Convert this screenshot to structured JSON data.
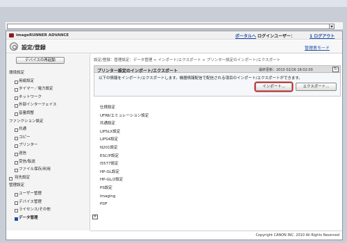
{
  "header": {
    "brand": "imageRUNNER ADVANCE",
    "portal_link": "ポータルへ",
    "user_label": "ログインユーザー：",
    "logout_link": "1 ログアウト"
  },
  "title_bar": {
    "title": "設定/登録",
    "to_admin_link": "管理者モード"
  },
  "sidebar": {
    "restart_button": "デバイスの再起動",
    "items": [
      {
        "type": "heading",
        "label": "環境設定"
      },
      {
        "type": "item",
        "label": "用紙設定"
      },
      {
        "type": "item",
        "label": "タイマー／電力設定"
      },
      {
        "type": "item",
        "label": "ネットワーク"
      },
      {
        "type": "item",
        "label": "外部インターフェイス"
      },
      {
        "type": "item",
        "label": "音量調整"
      },
      {
        "type": "heading",
        "label": "ファンクション設定"
      },
      {
        "type": "item",
        "label": "共通"
      },
      {
        "type": "item",
        "label": "コピー"
      },
      {
        "type": "item",
        "label": "プリンター"
      },
      {
        "type": "item",
        "label": "送信"
      },
      {
        "type": "item",
        "label": "受信/転送"
      },
      {
        "type": "item",
        "label": "ファイル保存/利用"
      },
      {
        "type": "top",
        "label": "宛先設定"
      },
      {
        "type": "heading",
        "label": "管理設定"
      },
      {
        "type": "item",
        "label": "ユーザー管理"
      },
      {
        "type": "item",
        "label": "デバイス管理"
      },
      {
        "type": "item",
        "label": "ライセンス/その他"
      },
      {
        "type": "selected",
        "label": "データ管理"
      }
    ]
  },
  "main": {
    "breadcrumb": "設定/登録：管理設定：データ管理 > インポート/エクスポート > プリンター設定のインポート/エクスポート",
    "panel_title": "プリンター設定のインポート/エクスポート",
    "updated": "最終更新：2010 02/16 18:02:00",
    "description": "以下の情報をインポート/エクスポートします。機器情報配信で配信される項目のインポート/エクスポートができます。",
    "import_button": "インポート...",
    "export_button": "エクスポート...",
    "settings": [
      "仕様設定",
      "UFRⅡ/エミュレーション設定",
      "共通設定",
      "LIPSLX設定",
      "LIPS4設定",
      "N201設定",
      "ESC/P設定",
      "I5577設定",
      "HP-GL設定",
      "HP-GL/2設定",
      "PS設定",
      "Imaging",
      "PDF"
    ]
  },
  "footer": {
    "copyright": "Copyright CANON INC. 2010 All Rights Reserved"
  },
  "colors": {
    "link": "#1b4ea6",
    "highlight": "#d21d1d"
  }
}
